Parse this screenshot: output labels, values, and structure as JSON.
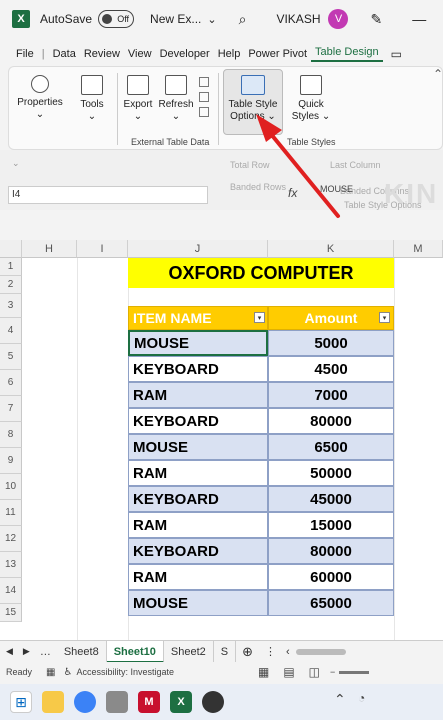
{
  "titlebar": {
    "autosave_label": "AutoSave",
    "toggle_state": "Off",
    "filename": "New Ex...",
    "username": "VIKASH",
    "avatar_initial": "V"
  },
  "menu": [
    "File",
    "Data",
    "Review",
    "View",
    "Developer",
    "Help",
    "Power Pivot",
    "Table Design"
  ],
  "ribbon": {
    "properties": "Properties",
    "tools": "Tools",
    "export": "Export",
    "refresh": "Refresh",
    "external_group": "External Table Data",
    "table_style_options_1": "Table Style",
    "table_style_options_2": "Options",
    "quick_styles_1": "Quick",
    "quick_styles_2": "Styles",
    "table_styles_group": "Table Styles"
  },
  "faded_options": {
    "total_row": "Total Row",
    "banded_rows": "Banded Rows",
    "last_column": "Last Column",
    "banded_columns": "Banded Columns",
    "style_options_label": "Table Style Options"
  },
  "namebox": "I4",
  "fx_label": "fx",
  "formula_value": "MOUSE",
  "watermark": "KIN",
  "columns": [
    "H",
    "I",
    "J",
    "K",
    "M"
  ],
  "rows": [
    "1",
    "2",
    "3",
    "4",
    "5",
    "6",
    "7",
    "8",
    "9",
    "10",
    "11",
    "12",
    "13",
    "14",
    "15"
  ],
  "table": {
    "title": "OXFORD COMPUTER",
    "headers": [
      "ITEM NAME",
      "Amount"
    ],
    "rows": [
      [
        "MOUSE",
        "5000"
      ],
      [
        "KEYBOARD",
        "4500"
      ],
      [
        "RAM",
        "7000"
      ],
      [
        "KEYBOARD",
        "80000"
      ],
      [
        "MOUSE",
        "6500"
      ],
      [
        "RAM",
        "50000"
      ],
      [
        "KEYBOARD",
        "45000"
      ],
      [
        "RAM",
        "15000"
      ],
      [
        "KEYBOARD",
        "80000"
      ],
      [
        "RAM",
        "60000"
      ],
      [
        "MOUSE",
        "65000"
      ]
    ]
  },
  "sheet_tabs": [
    "Sheet8",
    "Sheet10",
    "Sheet2",
    "S"
  ],
  "status": {
    "ready": "Ready",
    "accessibility": "Accessibility: Investigate"
  },
  "colors": {
    "accent": "#1d6f42",
    "title_fill": "#ffff00",
    "header_fill": "#ffcc00",
    "band_fill": "#d9e1f2",
    "arrow": "#e02020"
  }
}
